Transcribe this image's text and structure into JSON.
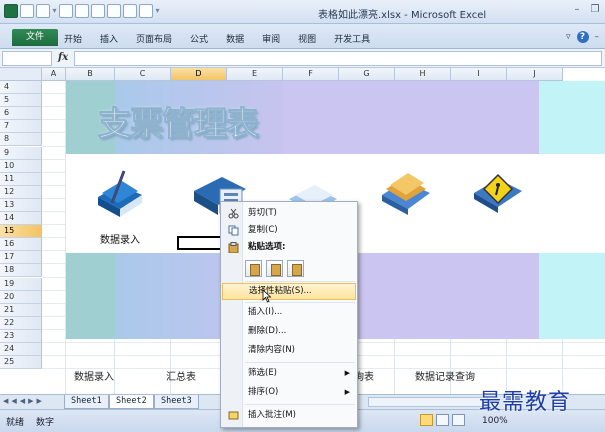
{
  "window": {
    "title": "表格如此漂亮.xlsx - Microsoft Excel"
  },
  "ribbon": {
    "file_tab": "文件",
    "tabs": [
      "开始",
      "插入",
      "页面布局",
      "公式",
      "数据",
      "审阅",
      "视图",
      "开发工具"
    ]
  },
  "formula_bar": {
    "fx_label": "fx"
  },
  "columns": [
    "A",
    "B",
    "C",
    "D",
    "E",
    "F",
    "G",
    "H",
    "I",
    "J"
  ],
  "selected_column": "D",
  "rows": [
    "4",
    "5",
    "6",
    "7",
    "8",
    "9",
    "10",
    "11",
    "12",
    "13",
    "14",
    "15",
    "16",
    "17",
    "18",
    "19",
    "20",
    "21",
    "22",
    "23",
    "24",
    "25"
  ],
  "selected_row": "15",
  "dashboard": {
    "title": "支票管理表",
    "icon_label": "数据录入",
    "nav": {
      "data_entry": "数据录入",
      "summary": "汇总表",
      "query": "查询表",
      "record_query": "数据记录查询"
    }
  },
  "context_menu": {
    "cut": "剪切(T)",
    "copy": "复制(C)",
    "paste_options": "粘贴选项:",
    "paste_special": "选择性粘贴(S)...",
    "insert": "插入(I)...",
    "delete": "删除(D)...",
    "clear": "清除内容(N)",
    "filter": "筛选(E)",
    "sort": "排序(O)",
    "insert_comment": "插入批注(M)"
  },
  "sheets": [
    "Sheet1",
    "Sheet2",
    "Sheet3"
  ],
  "active_sheet": "Sheet2",
  "status": {
    "mode": "就绪",
    "num": "数字",
    "zoom": "100%"
  },
  "watermark": "最需教育",
  "colors": {
    "excel_green": "#207245",
    "highlight": "#fde4a0"
  }
}
